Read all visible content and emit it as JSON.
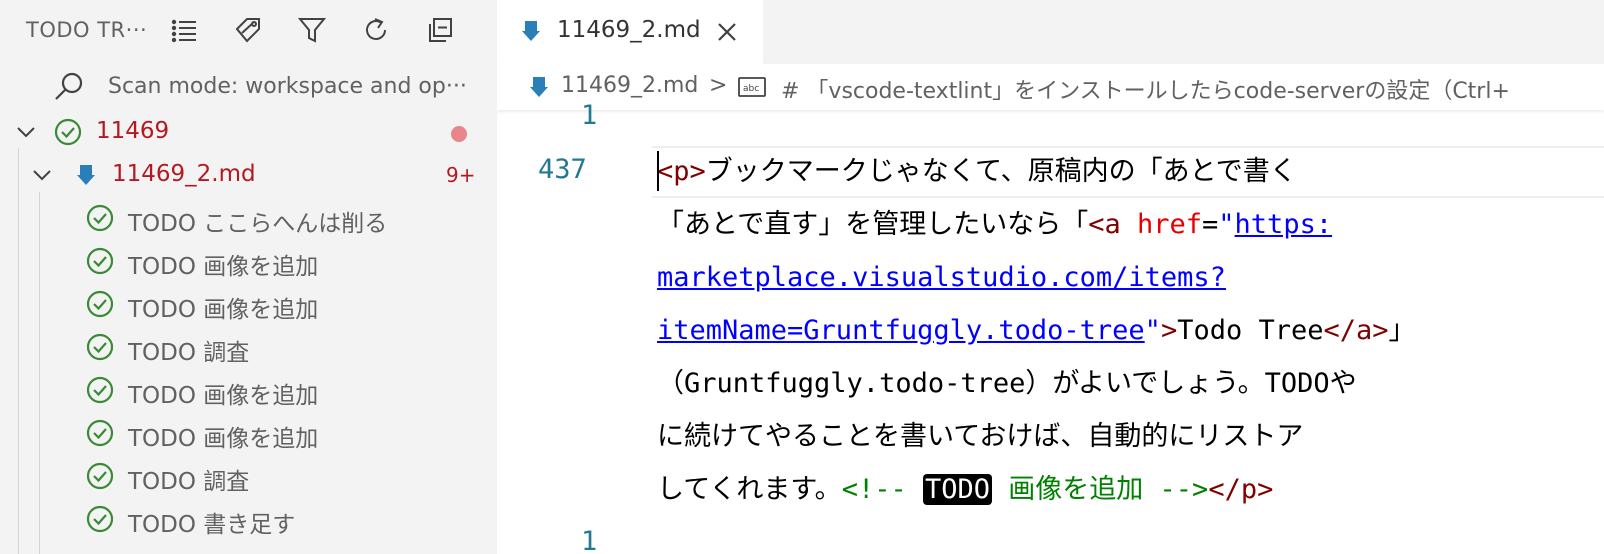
{
  "sidebar": {
    "title": "TODO TR···",
    "header_icons": [
      "list-view-icon",
      "tag-icon",
      "filter-icon",
      "refresh-icon",
      "collapse-all-icon"
    ],
    "scan_mode_text": "Scan mode: workspace and op···",
    "folder": {
      "label": "11469",
      "status_color": "#e8868b"
    },
    "file": {
      "label": "11469_2.md",
      "badge": "9+"
    },
    "todos": [
      {
        "label": "TODO ここらへんは削る"
      },
      {
        "label": "TODO 画像を追加"
      },
      {
        "label": "TODO 画像を追加"
      },
      {
        "label": "TODO 調査"
      },
      {
        "label": "TODO 画像を追加"
      },
      {
        "label": "TODO 画像を追加"
      },
      {
        "label": "TODO 調査"
      },
      {
        "label": "TODO 書き足す"
      }
    ]
  },
  "editor": {
    "tab": {
      "label": "11469_2.md"
    },
    "breadcrumb": {
      "file": "11469_2.md",
      "separator": ">",
      "heading": "# 「vscode-textlint」をインストールしたらcode-serverの設定（Ctrl+"
    },
    "gutter": {
      "top_partial": "1",
      "current": "437",
      "bottom_partial": "1"
    },
    "code": {
      "l1_tag_open": "<p>",
      "l1_text": "ブックマークじゃなくて、原稿内の「あとで書く",
      "l2_text": "「あとで直す」を管理したいなら「",
      "l2_tag_a": "<a",
      "l2_attr": "href",
      "l2_eq": "=",
      "l2_quote": "\"",
      "l2_url": "https:",
      "l3_url": "marketplace.visualstudio.com/items?",
      "l4_url": "itemName=Gruntfuggly.todo-tree",
      "l4_quote": "\"",
      "l4_gt": ">",
      "l4_text": "Todo Tree",
      "l4_close": "</a>",
      "l4_tail": "」",
      "l5_text": "（Gruntfuggly.todo-tree）がよいでしょう。TODOや",
      "l6_text": "に続けてやることを書いておけば、自動的にリストア",
      "l7_text": "してくれます。",
      "l7_comment_open": "<!--",
      "l7_todo": "TODO",
      "l7_comment_text": "画像を追加",
      "l7_comment_close": "-->",
      "l7_tag_close": "</p>"
    },
    "colors": {
      "tag": "#800000",
      "attr": "#e50000",
      "link": "#0000ff",
      "comment": "#008000",
      "line_number": "#237893"
    }
  }
}
